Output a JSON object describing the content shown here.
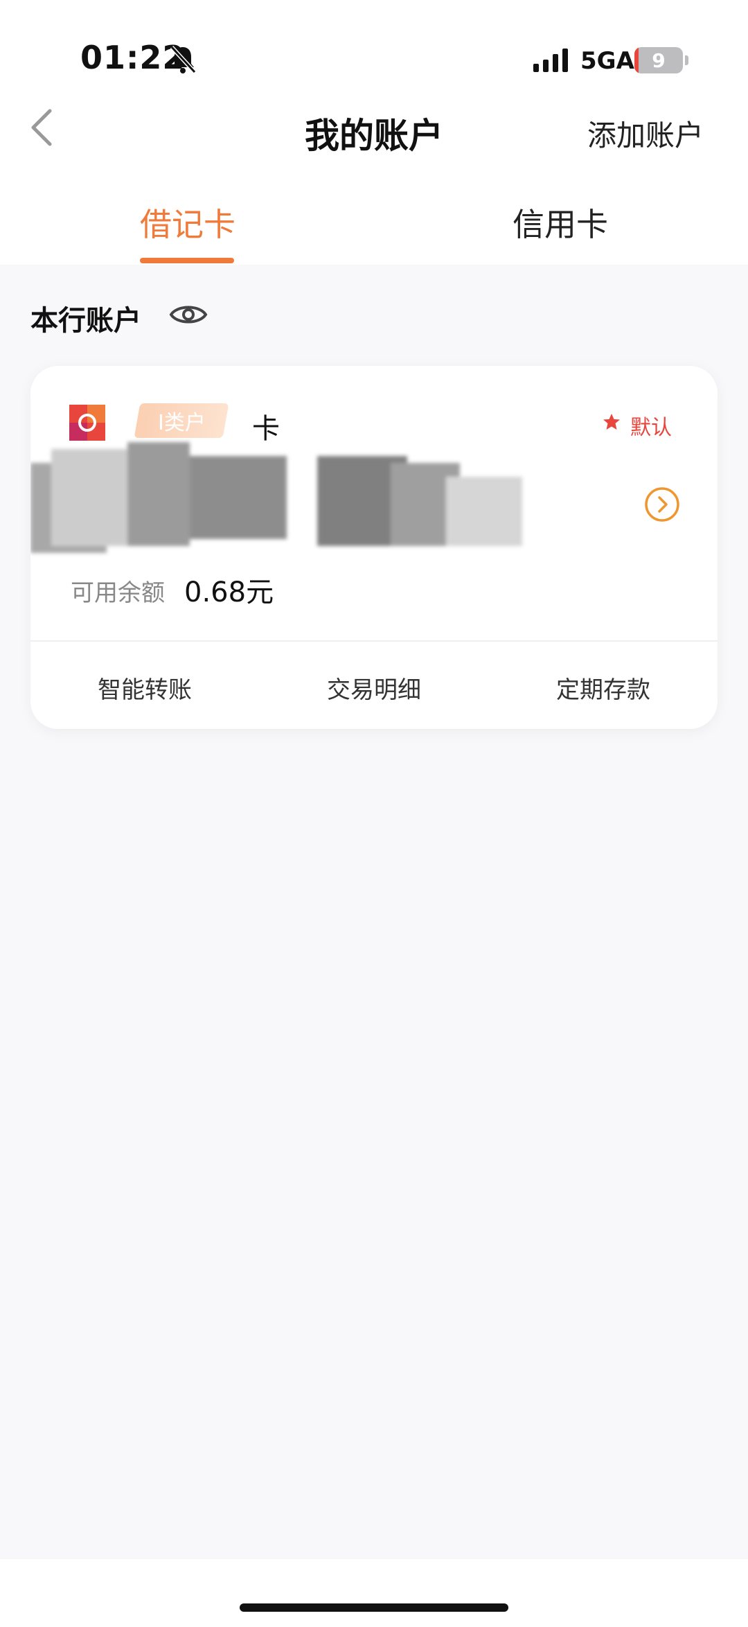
{
  "status_bar": {
    "time": "01:22",
    "network": "5GA",
    "battery_level": "9",
    "icons": [
      "bell-off-icon",
      "signal-icon"
    ]
  },
  "header": {
    "title": "我的账户",
    "action_label": "添加账户",
    "back_icon": "chevron-left-icon"
  },
  "tabs": [
    {
      "label": "借记卡",
      "active": true
    },
    {
      "label": "信用卡",
      "active": false
    }
  ],
  "section": {
    "title": "本行账户",
    "visibility_icon": "eye-icon"
  },
  "account_card": {
    "tag": "I类户",
    "card_type": "卡",
    "default_label": "默认",
    "balance_label": "可用余额",
    "balance_value": "0.68元",
    "actions": [
      "智能转账",
      "交易明细",
      "定期存款"
    ]
  },
  "colors": {
    "accent": "#f07a3a",
    "default_red": "#e8453c",
    "background": "#f8f8fa"
  }
}
